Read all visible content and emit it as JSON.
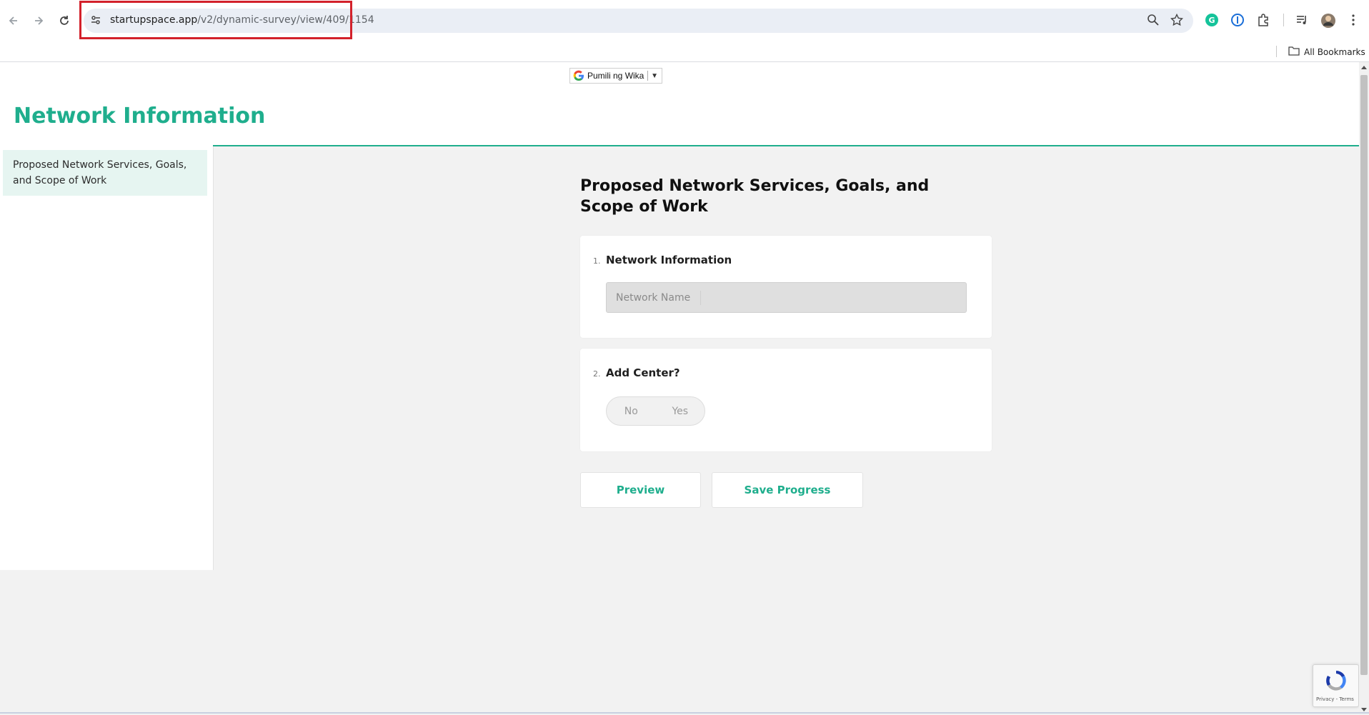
{
  "browser": {
    "url_domain": "startupspace.app",
    "url_path": "/v2/dynamic-survey/view/409/1154",
    "bookmarks_label": "All Bookmarks"
  },
  "translate": {
    "label": "Pumili ng Wika",
    "caret": "▼"
  },
  "page": {
    "title": "Network Information",
    "sidebar": {
      "items": [
        {
          "label": "Proposed Network Services, Goals, and Scope of Work"
        }
      ]
    },
    "section_heading": "Proposed Network Services, Goals, and Scope of Work",
    "questions": [
      {
        "number": "1.",
        "label": "Network Information",
        "placeholder": "Network Name"
      },
      {
        "number": "2.",
        "label": "Add Center?",
        "options": [
          "No",
          "Yes"
        ]
      }
    ],
    "buttons": {
      "preview": "Preview",
      "save": "Save Progress"
    }
  },
  "recaptcha": {
    "text": "Privacy - Terms"
  },
  "colors": {
    "accent": "#1fae8d",
    "highlight_box": "#d3212b"
  }
}
